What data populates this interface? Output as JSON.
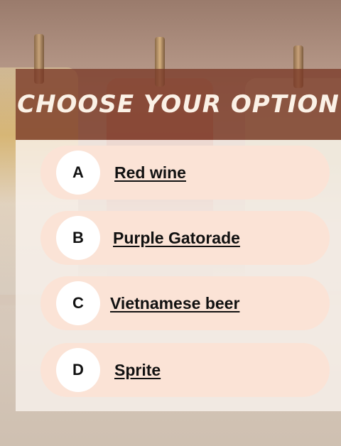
{
  "title": "CHOOSE YOUR OPTION",
  "options": [
    {
      "letter": "A",
      "label": "Red wine"
    },
    {
      "letter": "B",
      "label": "Purple Gatorade"
    },
    {
      "letter": "C",
      "label": "Vietnamese beer"
    },
    {
      "letter": "D",
      "label": "Sprite"
    }
  ],
  "colors": {
    "header_band": "#7a3a28",
    "option_pill": "#fbe3d6",
    "letter_circle": "#ffffff",
    "title_text": "#fbf1e6"
  }
}
